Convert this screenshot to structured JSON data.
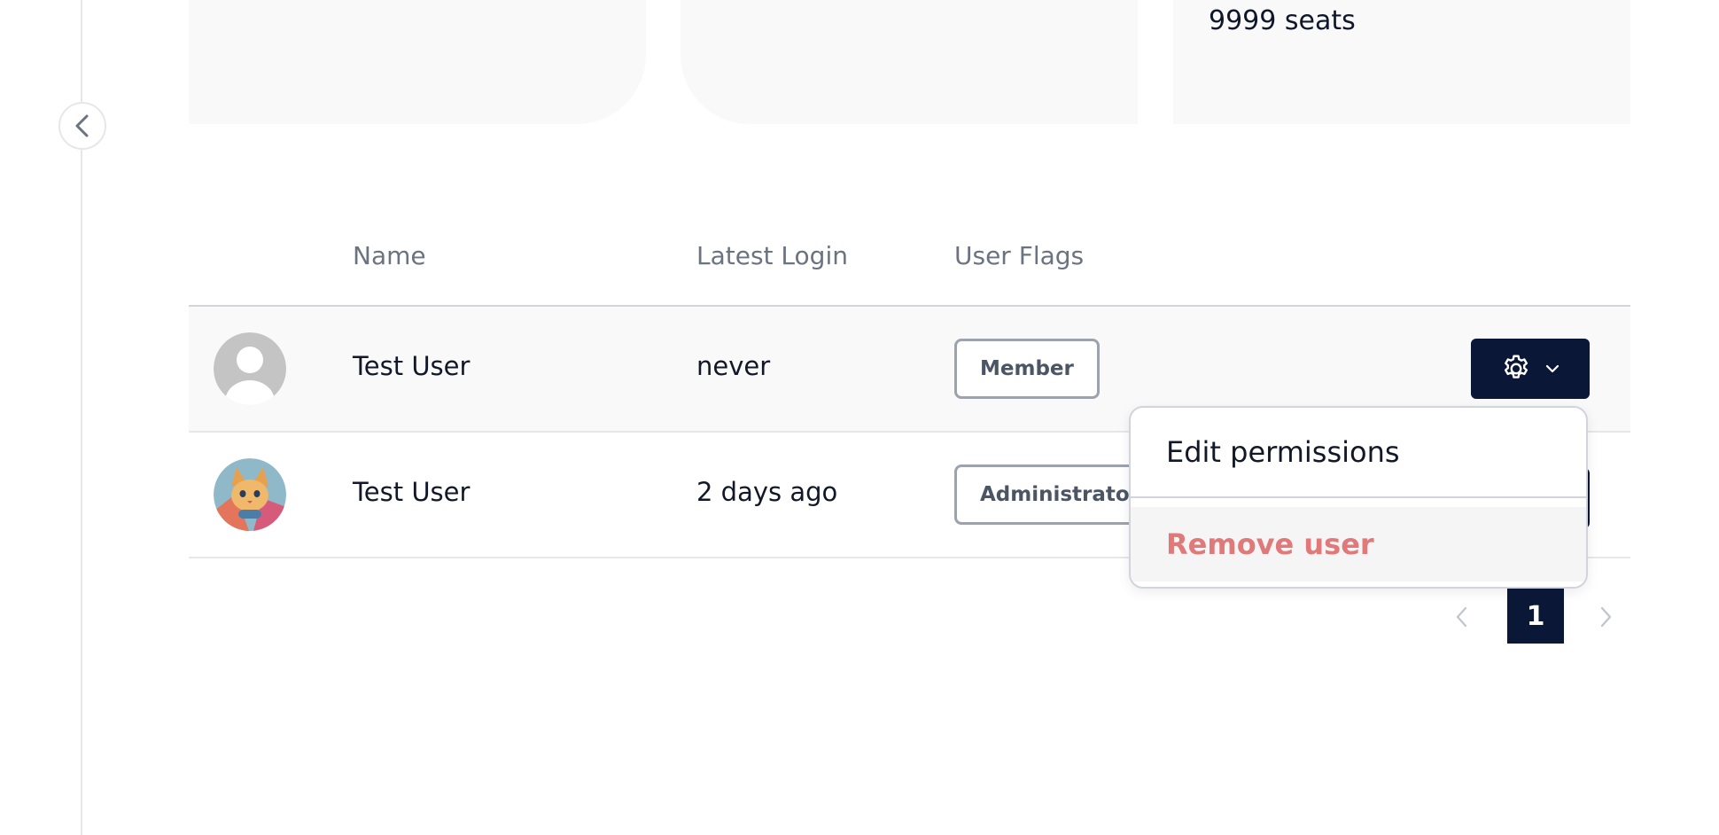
{
  "license": {
    "seats": "9999 seats"
  },
  "table": {
    "columns": {
      "name": "Name",
      "latest_login": "Latest Login",
      "user_flags": "User Flags"
    },
    "rows": [
      {
        "name": "Test User",
        "latest_login": "never",
        "flag": "Member",
        "avatar": "default-avatar-icon"
      },
      {
        "name": "Test User",
        "latest_login": "2 days ago",
        "flag": "Administrator",
        "avatar": "cat-avatar-image"
      }
    ]
  },
  "dropdown": {
    "edit_label": "Edit permissions",
    "remove_label": "Remove user"
  },
  "pagination": {
    "current": "1"
  },
  "colors": {
    "primary_dark": "#0b1736",
    "danger": "#e07979",
    "muted_text": "#6b7280",
    "card_bg": "#f9f9f9"
  },
  "icons": [
    "chevron-left-icon",
    "gear-icon",
    "chevron-down-icon",
    "chevron-right-icon"
  ]
}
